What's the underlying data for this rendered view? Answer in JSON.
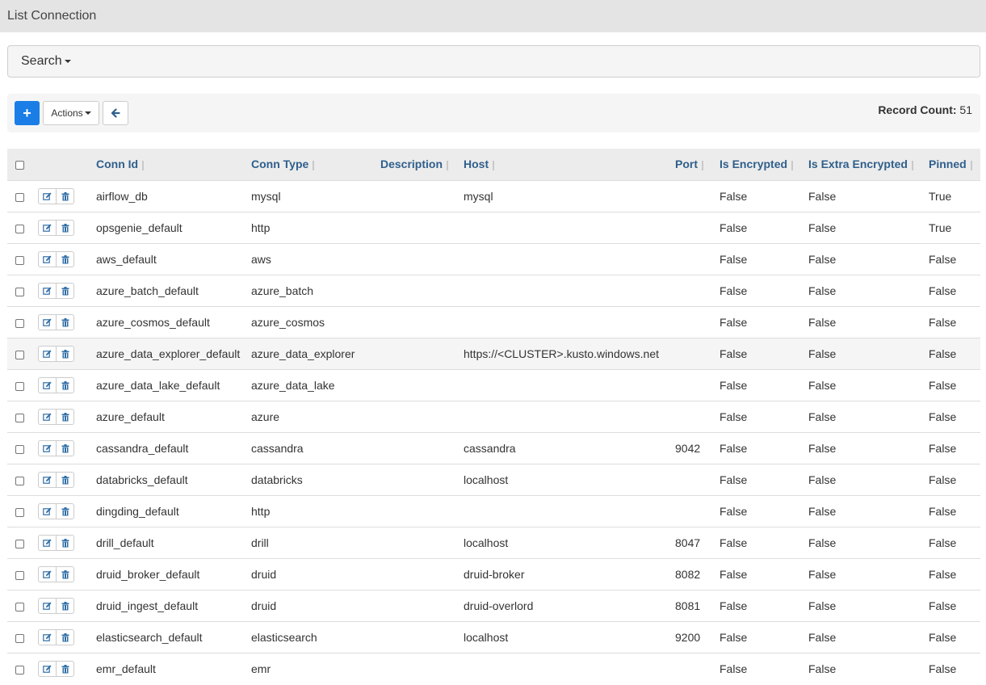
{
  "page": {
    "title": "List Connection"
  },
  "search": {
    "label": "Search"
  },
  "toolbar": {
    "add_label": "+",
    "actions_label": "Actions",
    "record_count_label": "Record Count:",
    "record_count_value": "51"
  },
  "table": {
    "columns": [
      "Conn Id",
      "Conn Type",
      "Description",
      "Host",
      "Port",
      "Is Encrypted",
      "Is Extra Encrypted",
      "Pinned"
    ],
    "rows": [
      {
        "conn_id": "airflow_db",
        "conn_type": "mysql",
        "description": "",
        "host": "mysql",
        "port": "",
        "is_encrypted": "False",
        "is_extra_encrypted": "False",
        "pinned": "True"
      },
      {
        "conn_id": "opsgenie_default",
        "conn_type": "http",
        "description": "",
        "host": "",
        "port": "",
        "is_encrypted": "False",
        "is_extra_encrypted": "False",
        "pinned": "True"
      },
      {
        "conn_id": "aws_default",
        "conn_type": "aws",
        "description": "",
        "host": "",
        "port": "",
        "is_encrypted": "False",
        "is_extra_encrypted": "False",
        "pinned": "False"
      },
      {
        "conn_id": "azure_batch_default",
        "conn_type": "azure_batch",
        "description": "",
        "host": "",
        "port": "",
        "is_encrypted": "False",
        "is_extra_encrypted": "False",
        "pinned": "False"
      },
      {
        "conn_id": "azure_cosmos_default",
        "conn_type": "azure_cosmos",
        "description": "",
        "host": "",
        "port": "",
        "is_encrypted": "False",
        "is_extra_encrypted": "False",
        "pinned": "False"
      },
      {
        "conn_id": "azure_data_explorer_default",
        "conn_type": "azure_data_explorer",
        "description": "",
        "host": "https://<CLUSTER>.kusto.windows.net",
        "port": "",
        "is_encrypted": "False",
        "is_extra_encrypted": "False",
        "pinned": "False"
      },
      {
        "conn_id": "azure_data_lake_default",
        "conn_type": "azure_data_lake",
        "description": "",
        "host": "",
        "port": "",
        "is_encrypted": "False",
        "is_extra_encrypted": "False",
        "pinned": "False"
      },
      {
        "conn_id": "azure_default",
        "conn_type": "azure",
        "description": "",
        "host": "",
        "port": "",
        "is_encrypted": "False",
        "is_extra_encrypted": "False",
        "pinned": "False"
      },
      {
        "conn_id": "cassandra_default",
        "conn_type": "cassandra",
        "description": "",
        "host": "cassandra",
        "port": "9042",
        "is_encrypted": "False",
        "is_extra_encrypted": "False",
        "pinned": "False"
      },
      {
        "conn_id": "databricks_default",
        "conn_type": "databricks",
        "description": "",
        "host": "localhost",
        "port": "",
        "is_encrypted": "False",
        "is_extra_encrypted": "False",
        "pinned": "False"
      },
      {
        "conn_id": "dingding_default",
        "conn_type": "http",
        "description": "",
        "host": "",
        "port": "",
        "is_encrypted": "False",
        "is_extra_encrypted": "False",
        "pinned": "False"
      },
      {
        "conn_id": "drill_default",
        "conn_type": "drill",
        "description": "",
        "host": "localhost",
        "port": "8047",
        "is_encrypted": "False",
        "is_extra_encrypted": "False",
        "pinned": "False"
      },
      {
        "conn_id": "druid_broker_default",
        "conn_type": "druid",
        "description": "",
        "host": "druid-broker",
        "port": "8082",
        "is_encrypted": "False",
        "is_extra_encrypted": "False",
        "pinned": "False"
      },
      {
        "conn_id": "druid_ingest_default",
        "conn_type": "druid",
        "description": "",
        "host": "druid-overlord",
        "port": "8081",
        "is_encrypted": "False",
        "is_extra_encrypted": "False",
        "pinned": "False"
      },
      {
        "conn_id": "elasticsearch_default",
        "conn_type": "elasticsearch",
        "description": "",
        "host": "localhost",
        "port": "9200",
        "is_encrypted": "False",
        "is_extra_encrypted": "False",
        "pinned": "False"
      },
      {
        "conn_id": "emr_default",
        "conn_type": "emr",
        "description": "",
        "host": "",
        "port": "",
        "is_encrypted": "False",
        "is_extra_encrypted": "False",
        "pinned": "False"
      }
    ],
    "highlighted_row": 5
  },
  "icons": {
    "add": "plus-icon",
    "back": "arrow-left-icon",
    "edit": "edit-icon",
    "delete": "trash-icon"
  },
  "colors": {
    "primary": "#1a7ee6",
    "header_link": "#2f5f8c",
    "action_icon": "#2f6da5"
  }
}
